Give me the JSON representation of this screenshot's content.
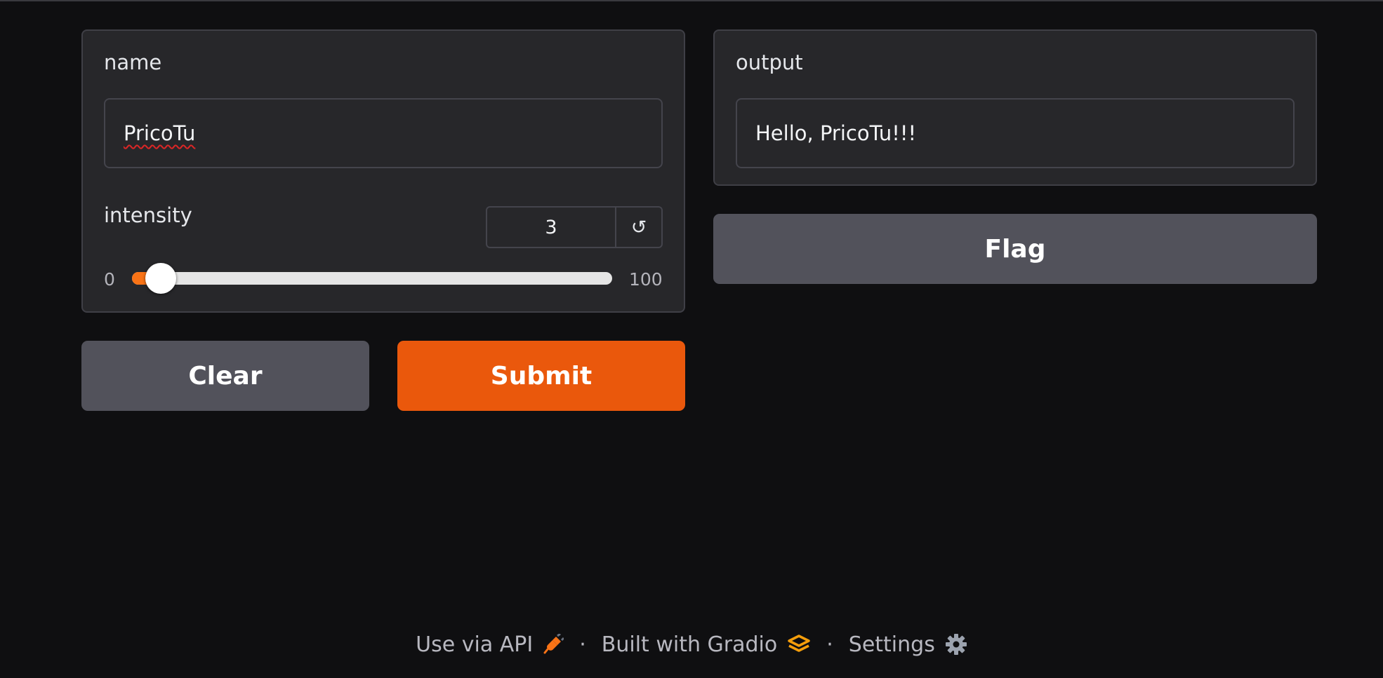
{
  "inputs": {
    "name": {
      "label": "name",
      "value": "PricoTu"
    },
    "intensity": {
      "label": "intensity",
      "value": "3",
      "min_label": "0",
      "max_label": "100",
      "level_percent": 3,
      "reset_glyph": "↺"
    }
  },
  "actions": {
    "clear_label": "Clear",
    "submit_label": "Submit"
  },
  "output": {
    "label": "output",
    "value": "Hello, PricoTu!!!",
    "flag_label": "Flag"
  },
  "footer": {
    "api_label": "Use via API",
    "api_icon": "plug-icon",
    "built_label": "Built with Gradio",
    "gradio_icon": "gradio-logo-icon",
    "settings_label": "Settings",
    "settings_icon": "gear-icon",
    "separator": "·"
  },
  "colors": {
    "background": "#0f0f11",
    "panel": "#27272a",
    "accent": "#ea580c",
    "secondary_button": "#52525b"
  }
}
